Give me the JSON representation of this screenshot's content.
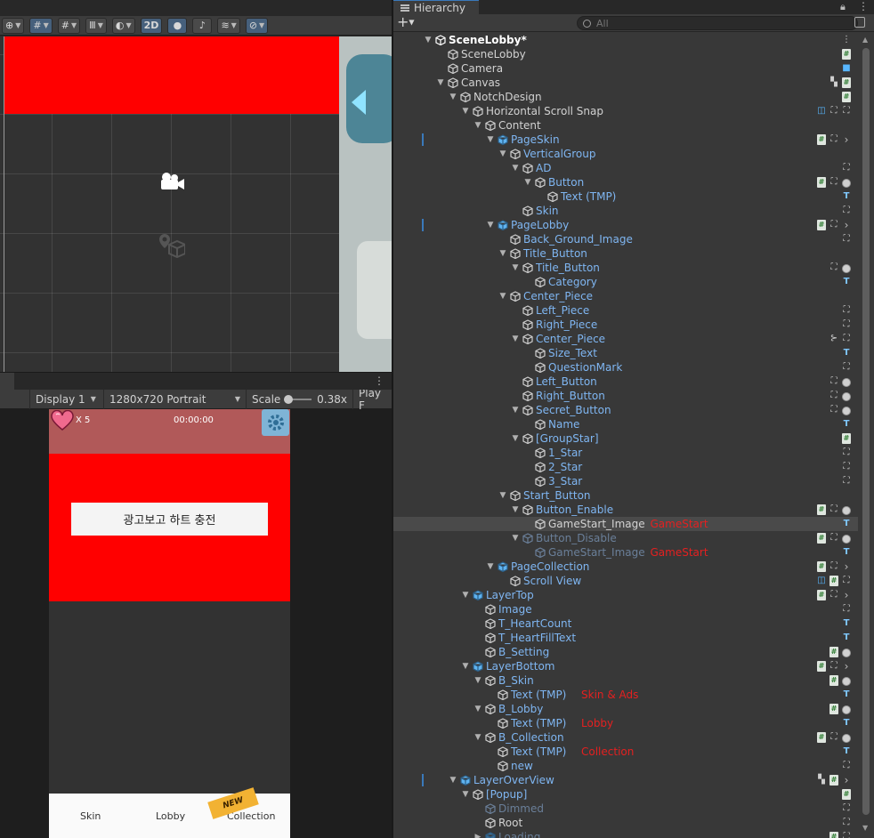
{
  "scene_toolbar": {
    "mode_2d_label": "2D"
  },
  "game_toolbar": {
    "display_label": "Display 1",
    "resolution_label": "1280x720 Portrait",
    "scale_label": "Scale",
    "scale_value": "0.38x",
    "play_label": "Play F"
  },
  "game_ui": {
    "heart_count": "X 5",
    "timer": "00:00:00",
    "ad_button_label": "광고보고 하트 충전",
    "bottom_buttons": [
      "Skin",
      "Lobby",
      "Collection"
    ],
    "new_badge": "NEW"
  },
  "hierarchy": {
    "tab_title": "Hierarchy",
    "search_placeholder": "All",
    "rows": [
      {
        "label": "SceneLobby*",
        "indent": 0,
        "fold": "down",
        "kind": "scene",
        "icons": [
          "menu"
        ]
      },
      {
        "label": "SceneLobby",
        "indent": 1,
        "fold": "",
        "kind": "go",
        "icons": [
          "script"
        ]
      },
      {
        "label": "Camera",
        "indent": 1,
        "fold": "",
        "kind": "go",
        "icons": [
          "cam"
        ]
      },
      {
        "label": "Canvas",
        "indent": 1,
        "fold": "down",
        "kind": "go",
        "icons": [
          "quad",
          "script"
        ]
      },
      {
        "label": "NotchDesign",
        "indent": 2,
        "fold": "down",
        "kind": "go",
        "icons": [
          "script"
        ]
      },
      {
        "label": "Horizontal Scroll Snap",
        "indent": 3,
        "fold": "down",
        "kind": "go",
        "icons": [
          "blue-sq",
          "grid",
          "grid"
        ]
      },
      {
        "label": "Content",
        "indent": 4,
        "fold": "down",
        "kind": "go",
        "icons": []
      },
      {
        "label": "PageSkin",
        "indent": 5,
        "fold": "down",
        "kind": "prefab",
        "mark": true,
        "icons": [
          "script",
          "grid",
          "chev"
        ]
      },
      {
        "label": "VerticalGroup",
        "indent": 6,
        "fold": "down",
        "kind": "go-blue",
        "icons": []
      },
      {
        "label": "AD",
        "indent": 7,
        "fold": "down",
        "kind": "go-blue",
        "icons": [
          "grid"
        ]
      },
      {
        "label": "Button",
        "indent": 8,
        "fold": "down",
        "kind": "go-blue",
        "icons": [
          "script",
          "grid",
          "circle"
        ]
      },
      {
        "label": "Text (TMP)",
        "indent": 9,
        "fold": "",
        "kind": "go-blue",
        "icons": [
          "text"
        ]
      },
      {
        "label": "Skin",
        "indent": 7,
        "fold": "",
        "kind": "go-blue",
        "icons": [
          "grid"
        ]
      },
      {
        "label": "PageLobby",
        "indent": 5,
        "fold": "down",
        "kind": "prefab",
        "mark": true,
        "icons": [
          "script",
          "grid",
          "chev"
        ]
      },
      {
        "label": "Back_Ground_Image",
        "indent": 6,
        "fold": "",
        "kind": "go-blue",
        "icons": [
          "grid"
        ]
      },
      {
        "label": "Title_Button",
        "indent": 6,
        "fold": "down",
        "kind": "go-blue",
        "icons": []
      },
      {
        "label": "Title_Button",
        "indent": 7,
        "fold": "down",
        "kind": "go-blue",
        "icons": [
          "grid",
          "circle"
        ]
      },
      {
        "label": "Category",
        "indent": 8,
        "fold": "",
        "kind": "go-blue",
        "icons": [
          "text"
        ]
      },
      {
        "label": "Center_Piece",
        "indent": 6,
        "fold": "down",
        "kind": "go-blue",
        "icons": []
      },
      {
        "label": "Left_Piece",
        "indent": 7,
        "fold": "",
        "kind": "go-blue",
        "icons": [
          "grid"
        ]
      },
      {
        "label": "Right_Piece",
        "indent": 7,
        "fold": "",
        "kind": "go-blue",
        "icons": [
          "grid"
        ]
      },
      {
        "label": "Center_Piece",
        "indent": 7,
        "fold": "down",
        "kind": "go-blue",
        "icons": [
          "fork",
          "grid"
        ]
      },
      {
        "label": "Size_Text",
        "indent": 8,
        "fold": "",
        "kind": "go-blue",
        "icons": [
          "text"
        ]
      },
      {
        "label": "QuestionMark",
        "indent": 8,
        "fold": "",
        "kind": "go-blue",
        "icons": [
          "grid"
        ]
      },
      {
        "label": "Left_Button",
        "indent": 7,
        "fold": "",
        "kind": "go-blue",
        "icons": [
          "grid",
          "circle"
        ]
      },
      {
        "label": "Right_Button",
        "indent": 7,
        "fold": "",
        "kind": "go-blue",
        "icons": [
          "grid",
          "circle"
        ]
      },
      {
        "label": "Secret_Button",
        "indent": 7,
        "fold": "down",
        "kind": "go-blue",
        "icons": [
          "grid",
          "circle"
        ]
      },
      {
        "label": "Name",
        "indent": 8,
        "fold": "",
        "kind": "go-blue",
        "icons": [
          "text"
        ]
      },
      {
        "label": "[GroupStar]",
        "indent": 7,
        "fold": "down",
        "kind": "go-blue",
        "icons": [
          "script"
        ]
      },
      {
        "label": "1_Star",
        "indent": 8,
        "fold": "",
        "kind": "go-blue",
        "icons": [
          "grid"
        ]
      },
      {
        "label": "2_Star",
        "indent": 8,
        "fold": "",
        "kind": "go-blue",
        "icons": [
          "grid"
        ]
      },
      {
        "label": "3_Star",
        "indent": 8,
        "fold": "",
        "kind": "go-blue",
        "icons": [
          "grid"
        ]
      },
      {
        "label": "Start_Button",
        "indent": 6,
        "fold": "down",
        "kind": "go-blue",
        "icons": []
      },
      {
        "label": "Button_Enable",
        "indent": 7,
        "fold": "down",
        "kind": "go-blue",
        "icons": [
          "script",
          "grid",
          "circle"
        ]
      },
      {
        "label": "GameStart_Image",
        "indent": 8,
        "fold": "",
        "kind": "go-white",
        "note": "GameStart",
        "selected": true,
        "icons": [
          "text"
        ]
      },
      {
        "label": "Button_Disable",
        "indent": 7,
        "fold": "down",
        "kind": "go-dim",
        "icons": [
          "script",
          "grid",
          "circle"
        ]
      },
      {
        "label": "GameStart_Image",
        "indent": 8,
        "fold": "",
        "kind": "go-dim",
        "note": "GameStart",
        "icons": [
          "text"
        ]
      },
      {
        "label": "PageCollection",
        "indent": 5,
        "fold": "down",
        "kind": "prefab",
        "icons": [
          "script",
          "grid",
          "chev"
        ]
      },
      {
        "label": "Scroll View",
        "indent": 6,
        "fold": "",
        "kind": "go-blue",
        "icons": [
          "blue-sq",
          "script",
          "grid"
        ]
      },
      {
        "label": "LayerTop",
        "indent": 3,
        "fold": "down",
        "kind": "prefab",
        "icons": [
          "script",
          "grid",
          "chev"
        ]
      },
      {
        "label": "Image",
        "indent": 4,
        "fold": "",
        "kind": "go-blue",
        "icons": [
          "grid"
        ]
      },
      {
        "label": "T_HeartCount",
        "indent": 4,
        "fold": "",
        "kind": "go-blue",
        "icons": [
          "text"
        ]
      },
      {
        "label": "T_HeartFillText",
        "indent": 4,
        "fold": "",
        "kind": "go-blue",
        "icons": [
          "text"
        ]
      },
      {
        "label": "B_Setting",
        "indent": 4,
        "fold": "",
        "kind": "go-blue",
        "icons": [
          "script",
          "circle"
        ]
      },
      {
        "label": "LayerBottom",
        "indent": 3,
        "fold": "down",
        "kind": "prefab",
        "icons": [
          "script",
          "grid",
          "chev"
        ]
      },
      {
        "label": "B_Skin",
        "indent": 4,
        "fold": "down",
        "kind": "go-blue",
        "icons": [
          "script",
          "circle"
        ]
      },
      {
        "label": "Text (TMP)",
        "indent": 5,
        "fold": "",
        "kind": "go-blue",
        "note": "Skin & Ads",
        "icons": [
          "text"
        ]
      },
      {
        "label": "B_Lobby",
        "indent": 4,
        "fold": "down",
        "kind": "go-blue",
        "icons": [
          "script",
          "circle"
        ]
      },
      {
        "label": "Text (TMP)",
        "indent": 5,
        "fold": "",
        "kind": "go-blue",
        "note": "Lobby",
        "icons": [
          "text"
        ]
      },
      {
        "label": "B_Collection",
        "indent": 4,
        "fold": "down",
        "kind": "go-blue",
        "icons": [
          "script",
          "grid",
          "circle"
        ]
      },
      {
        "label": "Text (TMP)",
        "indent": 5,
        "fold": "",
        "kind": "go-blue",
        "note": "Collection",
        "icons": [
          "text"
        ]
      },
      {
        "label": "new",
        "indent": 5,
        "fold": "",
        "kind": "go-blue",
        "icons": [
          "grid"
        ]
      },
      {
        "label": "LayerOverView",
        "indent": 2,
        "fold": "down",
        "kind": "prefab",
        "mark": true,
        "icons": [
          "quad",
          "script",
          "chev"
        ]
      },
      {
        "label": "[Popup]",
        "indent": 3,
        "fold": "down",
        "kind": "go-blue",
        "icons": [
          "script"
        ]
      },
      {
        "label": "Dimmed",
        "indent": 4,
        "fold": "",
        "kind": "go-dim",
        "icons": [
          "grid"
        ]
      },
      {
        "label": "Root",
        "indent": 4,
        "fold": "",
        "kind": "go-white",
        "icons": [
          "grid"
        ]
      },
      {
        "label": "Loading",
        "indent": 4,
        "fold": "right",
        "kind": "prefab-dim",
        "icons": [
          "script",
          "grid"
        ]
      }
    ]
  },
  "colors": {
    "selection_bg": "#4a4a4a",
    "prefab_blue": "#7fb6f2",
    "note_red": "#e42020",
    "game_top_bar": "#b15959",
    "game_red_panel": "#ff0000"
  }
}
